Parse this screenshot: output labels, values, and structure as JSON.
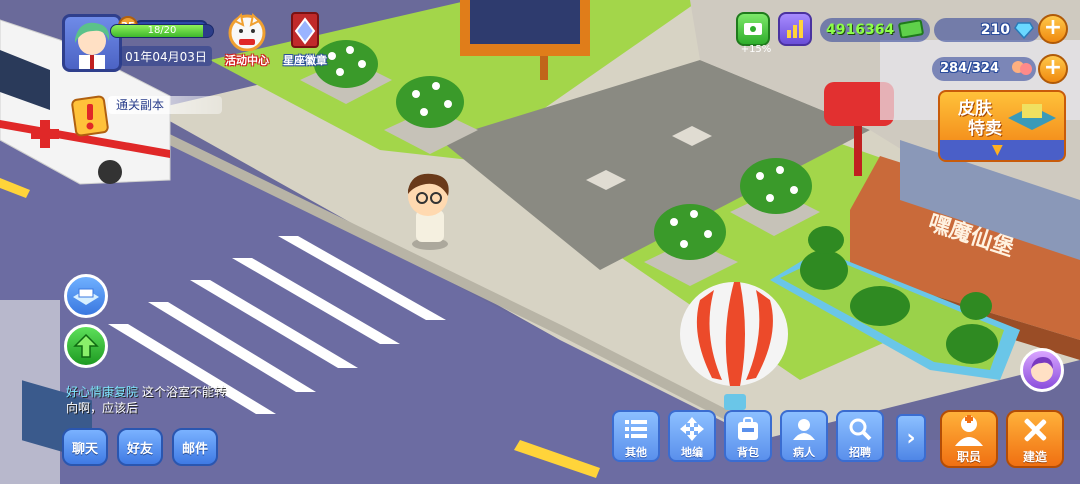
{
  "player": {
    "level": "35",
    "date": "01年04月03日"
  },
  "top_icons": {
    "events_label": "活动中心",
    "badge_label": "星座徽章"
  },
  "quest": {
    "title": "通关副本",
    "progress_text": "18/20",
    "progress_fraction": 0.9
  },
  "resources": {
    "boost_pct": "+15%",
    "cash": "4916364",
    "gems": "210",
    "population": "284/324"
  },
  "skin_sale": {
    "line1": "皮肤",
    "line2": "特卖"
  },
  "scene": {
    "sign_text": "嘿魔仙堡"
  },
  "chat": {
    "hospital_name": "好心情康复院",
    "message": "这个浴室不能转向啊，应该后"
  },
  "bottom_buttons": {
    "chat": "聊天",
    "friends": "好友",
    "mail": "邮件"
  },
  "toolbar": {
    "items": [
      {
        "label": "其他",
        "icon": "list-icon"
      },
      {
        "label": "地编",
        "icon": "move-arrows-icon"
      },
      {
        "label": "背包",
        "icon": "backpack-icon"
      },
      {
        "label": "病人",
        "icon": "patient-icon"
      },
      {
        "label": "招聘",
        "icon": "search-icon"
      }
    ],
    "more_icon": "chevron-right-icon"
  },
  "action_buttons": {
    "staff": "职员",
    "build": "建造"
  },
  "colors": {
    "accent_orange": "#f07d12",
    "toolbar_blue": "#5a90ec",
    "cash_green": "#8dff4a"
  }
}
